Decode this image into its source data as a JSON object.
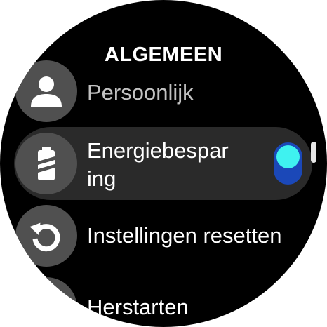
{
  "header": {
    "title": "ALGEMEEN"
  },
  "menu": {
    "items": [
      {
        "id": "persoonlijk",
        "label": "Persoonlijk",
        "icon": "person-icon"
      },
      {
        "id": "energiebesparing",
        "label_line1": "Energiebespar",
        "label_line2": "ing",
        "icon": "battery-saver-icon",
        "toggle_on": true
      },
      {
        "id": "instellingen-resetten",
        "label": "Instellingen resetten",
        "icon": "reset-icon"
      },
      {
        "id": "herstarten",
        "label": "Herstarten",
        "icon": "restart-icon"
      }
    ]
  },
  "colors": {
    "background": "#000000",
    "icon_circle": "#505050",
    "highlight_row": "#2a2a2a",
    "toggle_track": "#1b48b8",
    "toggle_knob": "#3ff2f0",
    "dimmed_text": "#c2c2c2"
  }
}
